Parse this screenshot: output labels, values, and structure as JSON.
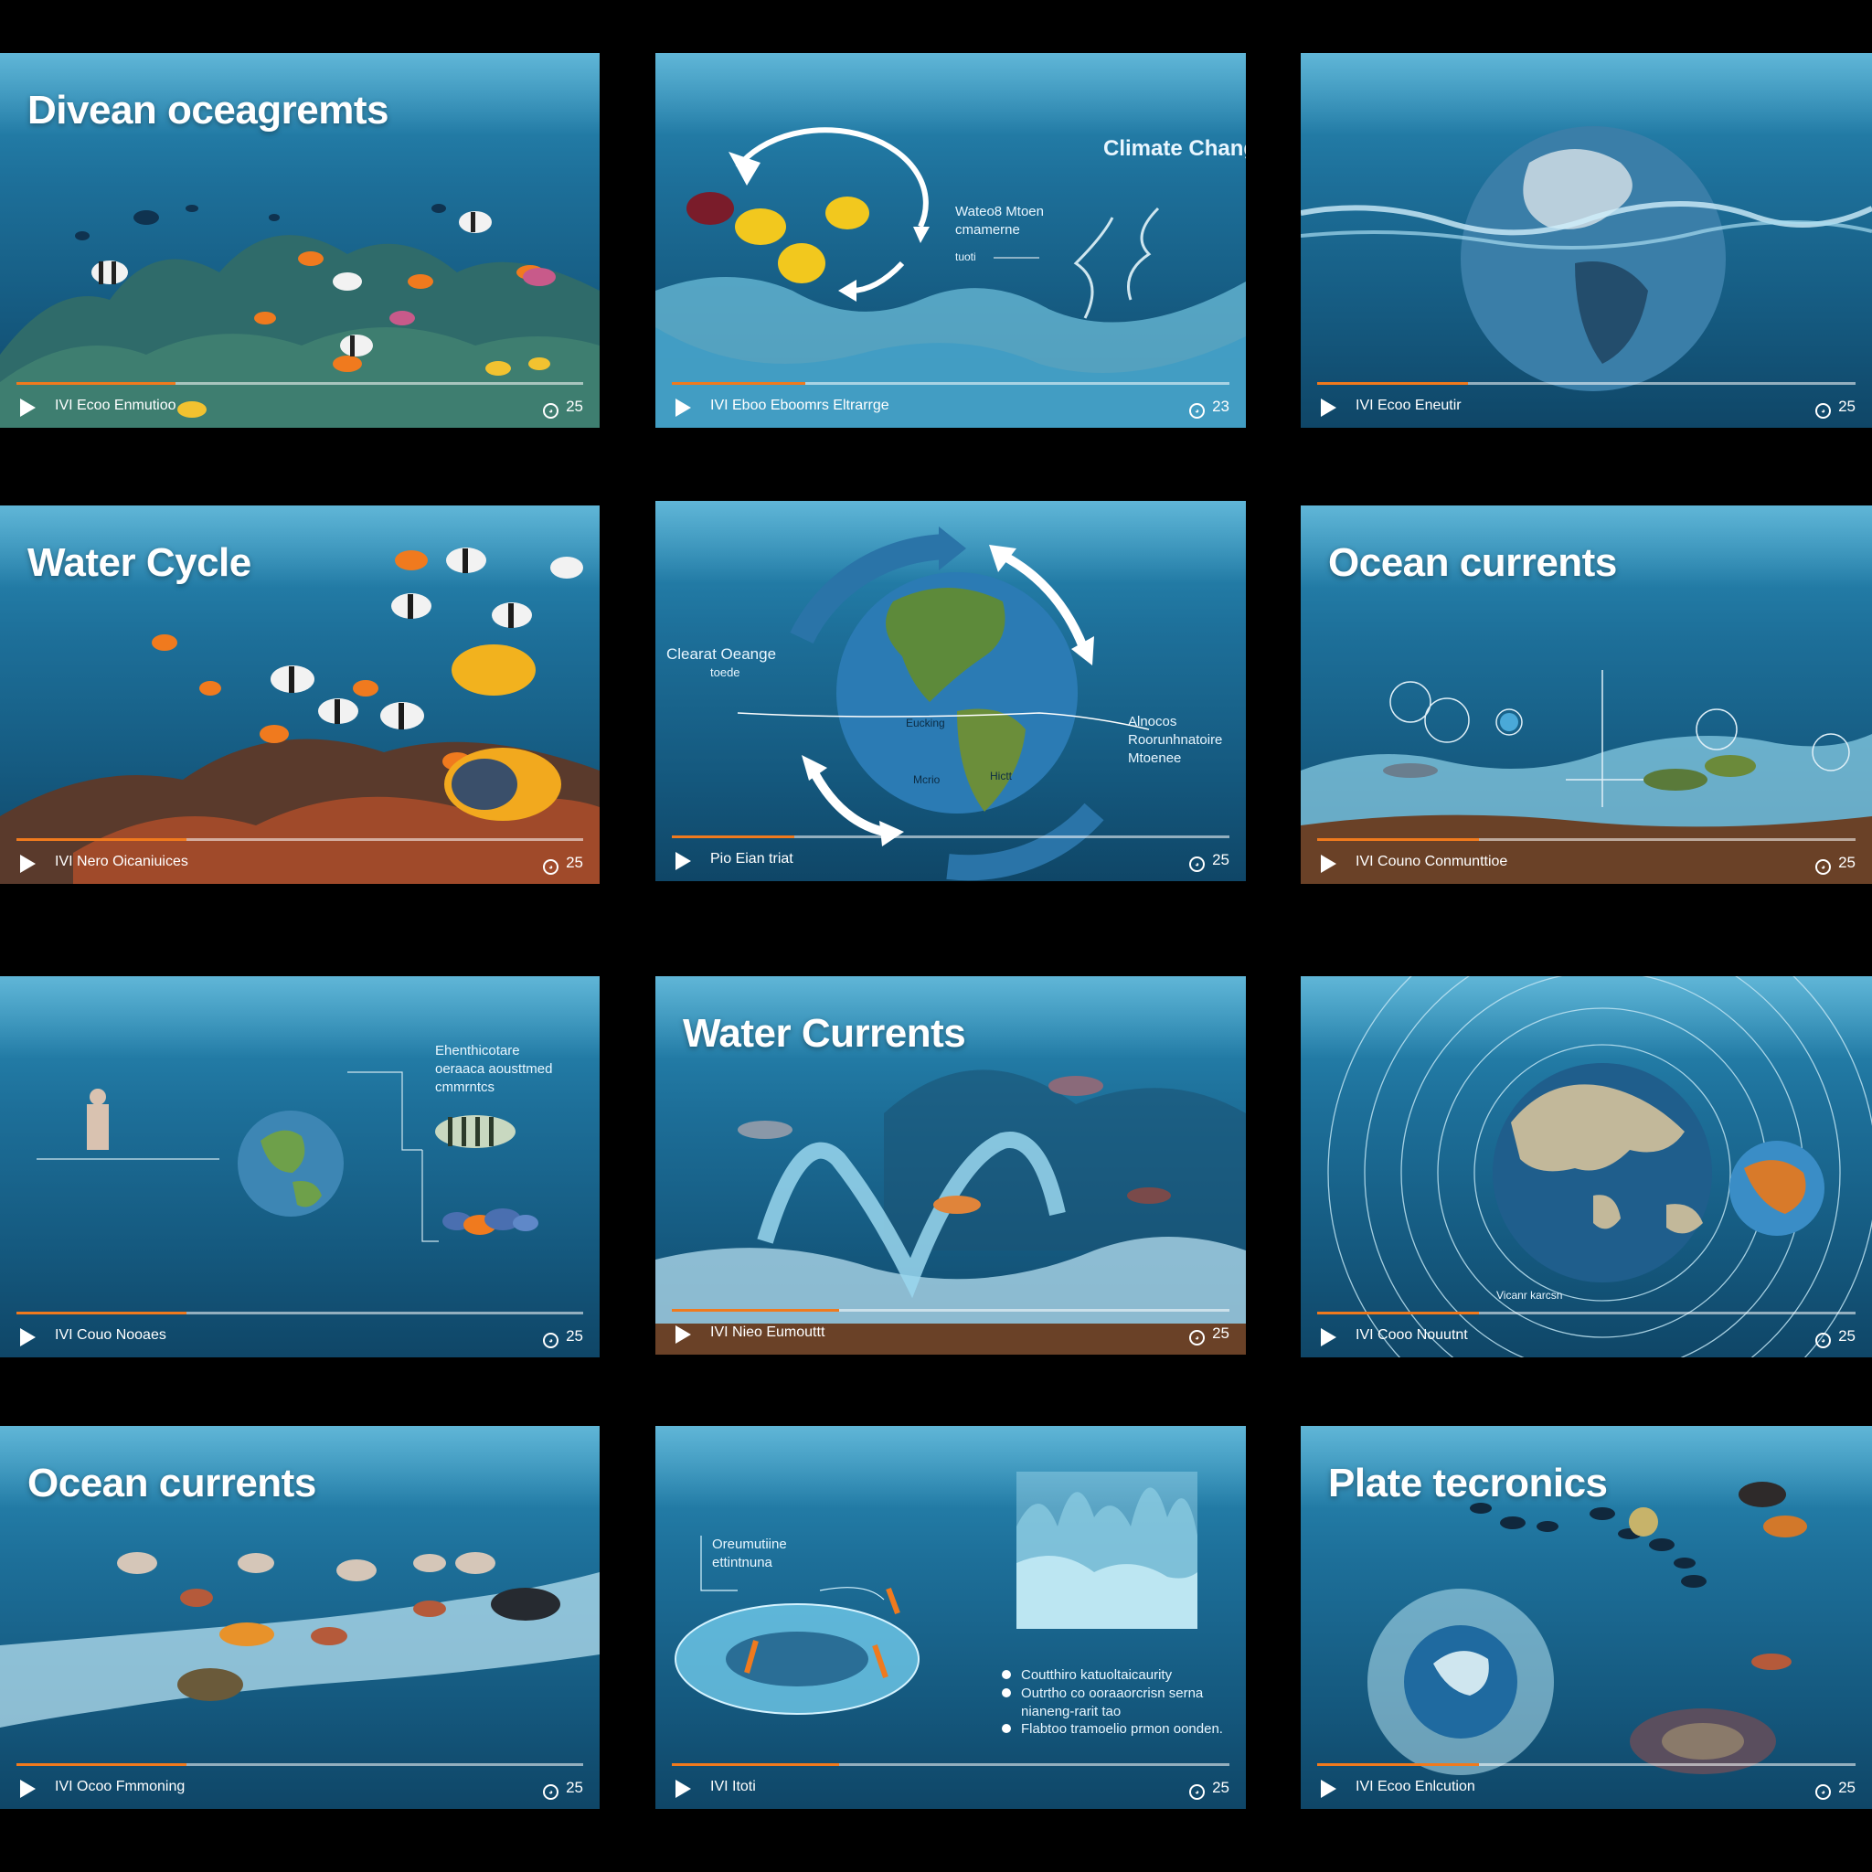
{
  "grid": {
    "tiles": [
      {
        "title": "Divean oceagremts",
        "labels": [],
        "controls": {
          "text": "IVI Ecoo Enmutioo",
          "count": "25",
          "progress": 0.28
        }
      },
      {
        "title": "",
        "labels": [
          "Climate Change",
          "Wateo8 Mtoen",
          "cmamerne",
          "tuoti"
        ],
        "controls": {
          "text": "IVI Eboo Eboomrs Eltrarrge",
          "count": "23",
          "progress": 0.24
        }
      },
      {
        "title": "",
        "labels": [],
        "controls": {
          "text": "IVI Ecoo Eneutir",
          "count": "25",
          "progress": 0.28
        }
      },
      {
        "title": "Water Cycle",
        "labels": [],
        "controls": {
          "text": "IVI Nero Oicaniuices",
          "count": "25",
          "progress": 0.3
        }
      },
      {
        "title": "",
        "labels": [
          "Clearat Oeange",
          "toede",
          "Eucking",
          "Alnocos",
          "Roorunhnatoire",
          "Mtoenee",
          "Mcrio",
          "Hictt"
        ],
        "controls": {
          "text": "Pio Eian triat",
          "count": "25",
          "progress": 0.22
        }
      },
      {
        "title": "Ocean currents",
        "labels": [],
        "controls": {
          "text": "IVI Couno Conmunttioe",
          "count": "25",
          "progress": 0.3
        }
      },
      {
        "title": "",
        "labels": [
          "Ehenthicotare",
          "oeraaca aousttmed",
          "cmmrntcs"
        ],
        "controls": {
          "text": "IVI Couo Nooaes",
          "count": "25",
          "progress": 0.3
        }
      },
      {
        "title": "Water Currents",
        "labels": [],
        "controls": {
          "text": "IVI Nieo Eumouttt",
          "count": "25",
          "progress": 0.3
        }
      },
      {
        "title": "",
        "labels": [
          "Vicanr karcsn"
        ],
        "controls": {
          "text": "IVI Cooo Nouutnt",
          "count": "25",
          "progress": 0.3
        }
      },
      {
        "title": "Ocean currents",
        "labels": [],
        "controls": {
          "text": "IVI Ocoo Fmmoning",
          "count": "25",
          "progress": 0.3
        }
      },
      {
        "title": "",
        "labels": [
          "Oreumutiine",
          "ettintnuna",
          "Coutthiro katuoltaicaurity",
          "Outrtho co ooraaorcrisn serna",
          "nianeng-rarit tao",
          "Flabtoo tramoelio prmon oonden."
        ],
        "controls": {
          "text": "IVI Itoti",
          "count": "25",
          "progress": 0.3
        }
      },
      {
        "title": "Plate tecronics",
        "labels": [],
        "controls": {
          "text": "IVI Ecoo Enlcution",
          "count": "25",
          "progress": 0.3
        }
      }
    ]
  },
  "colors": {
    "accent": "#f07a1e",
    "water": "#1d6f99",
    "background": "#000000"
  },
  "icons": [
    "play-icon",
    "captions-icon"
  ]
}
